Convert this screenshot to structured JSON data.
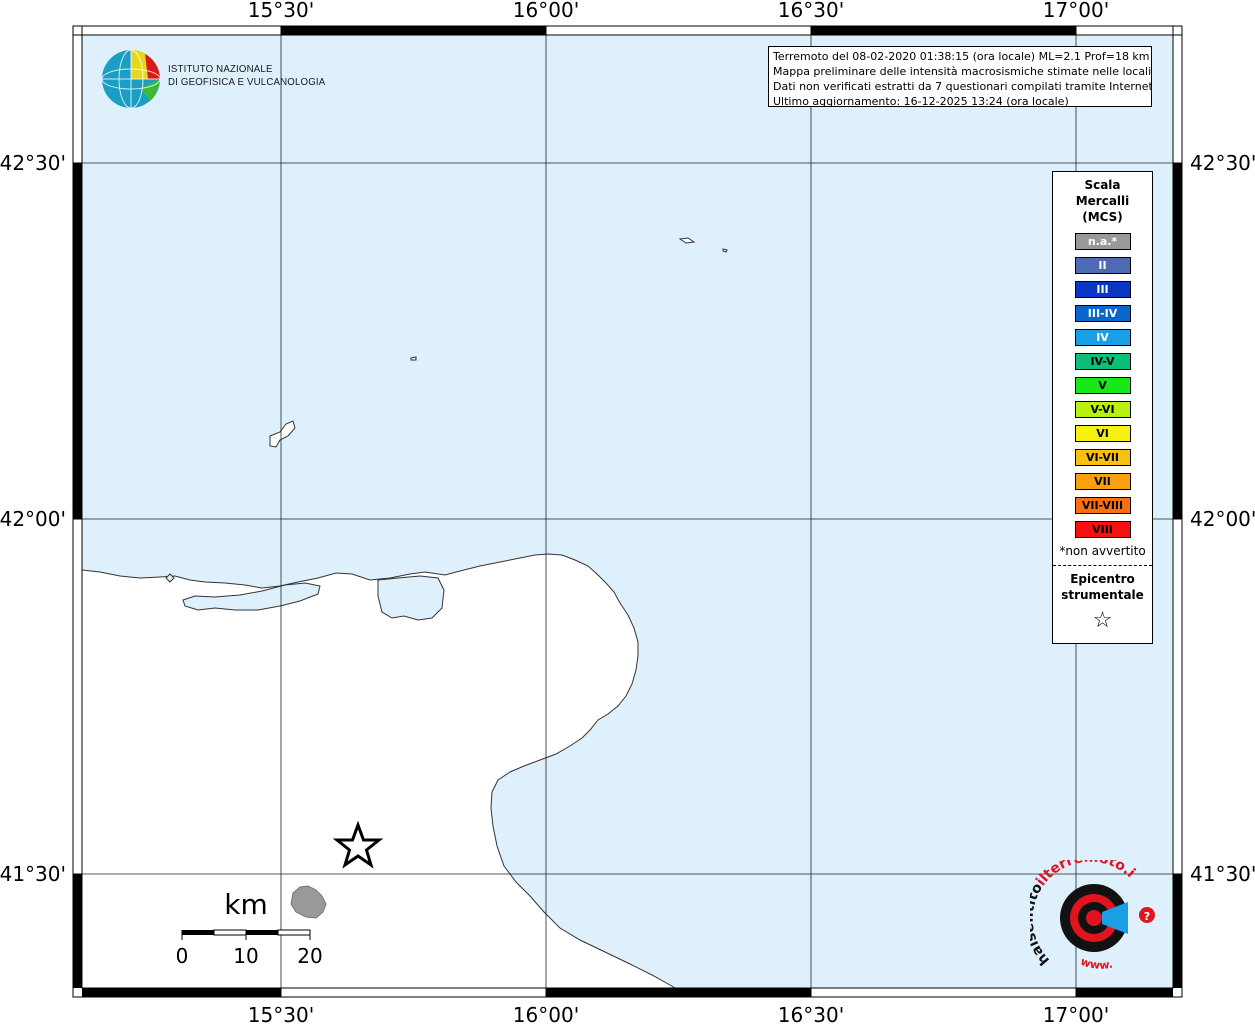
{
  "map": {
    "lon_labels": [
      "15°30'",
      "16°00'",
      "16°30'",
      "17°00'"
    ],
    "lat_labels": [
      "42°30'",
      "42°00'",
      "41°30'"
    ],
    "colors": {
      "sea": "#dff0fd",
      "land": "#ffffff",
      "island_fill": "#999999"
    }
  },
  "info": {
    "line1": "Terremoto del 08-02-2020 01:38:15 (ora locale) ML=2.1 Prof=18 km",
    "line2": "Mappa preliminare delle intensità macrosismiche stimate nelle località",
    "line3": "Dati non verificati estratti da 7 questionari compilati tramite Internet.",
    "line4": "Ultimo aggiornamento: 16-12-2025 13:24 (ora locale)"
  },
  "ingv": {
    "line1": "ISTITUTO NAZIONALE",
    "line2": "DI GEOFISICA E VULCANOLOGIA"
  },
  "legend": {
    "title_line1": "Scala",
    "title_line2": "Mercalli",
    "title_line3": "(MCS)",
    "classes": [
      {
        "label": "n.a.*",
        "color": "#999999"
      },
      {
        "label": "II",
        "color": "#4d6bb3"
      },
      {
        "label": "III",
        "color": "#0a36c4"
      },
      {
        "label": "III-IV",
        "color": "#0a66cc"
      },
      {
        "label": "IV",
        "color": "#1a9ee6"
      },
      {
        "label": "IV-V",
        "color": "#0cbf78"
      },
      {
        "label": "V",
        "color": "#18e818"
      },
      {
        "label": "V-VI",
        "color": "#b8f010"
      },
      {
        "label": "VI",
        "color": "#f8f010"
      },
      {
        "label": "VI-VII",
        "color": "#f8c010"
      },
      {
        "label": "VII",
        "color": "#f8a010"
      },
      {
        "label": "VII-VIII",
        "color": "#f87010"
      },
      {
        "label": "VIII",
        "color": "#f81010"
      }
    ],
    "na_note": "*non avvertito",
    "epicenter_line1": "Epicentro",
    "epicenter_line2": "strumentale",
    "epicenter_symbol": "☆"
  },
  "scalebar": {
    "unit": "km",
    "ticks": [
      "0",
      "10",
      "20"
    ]
  },
  "epicenter": {
    "symbol": "star-icon"
  },
  "hsit_logo": {
    "text_main": "haisentito",
    "text_it": "ilterremoto.it",
    "text_www": "www."
  }
}
